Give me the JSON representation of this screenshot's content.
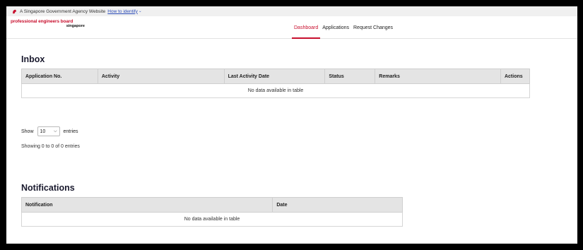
{
  "masthead": {
    "agency_text": "A Singapore Government Agency Website",
    "identify_link": "How to identify"
  },
  "brand": {
    "line1": "professional engineers board",
    "line2": "singapore"
  },
  "nav": {
    "items": [
      {
        "label": "Dashboard",
        "active": true
      },
      {
        "label": "Applications",
        "active": false
      },
      {
        "label": "Request Changes",
        "active": false
      }
    ]
  },
  "inbox": {
    "title": "Inbox",
    "columns": [
      "Application No.",
      "Activity",
      "Last Activity Date",
      "Status",
      "Remarks",
      "Actions"
    ],
    "empty_text": "No data available in table"
  },
  "length_menu": {
    "prefix": "Show",
    "value": "10",
    "suffix": "entries"
  },
  "info_text": "Showing 0 to 0 of 0 entries",
  "notifications": {
    "title": "Notifications",
    "columns": [
      "Notification",
      "Date"
    ],
    "empty_text": "No data available in table"
  },
  "colors": {
    "brand_red": "#c8102e",
    "link_blue": "#2a4bb8",
    "header_grey": "#e4e4e4"
  }
}
